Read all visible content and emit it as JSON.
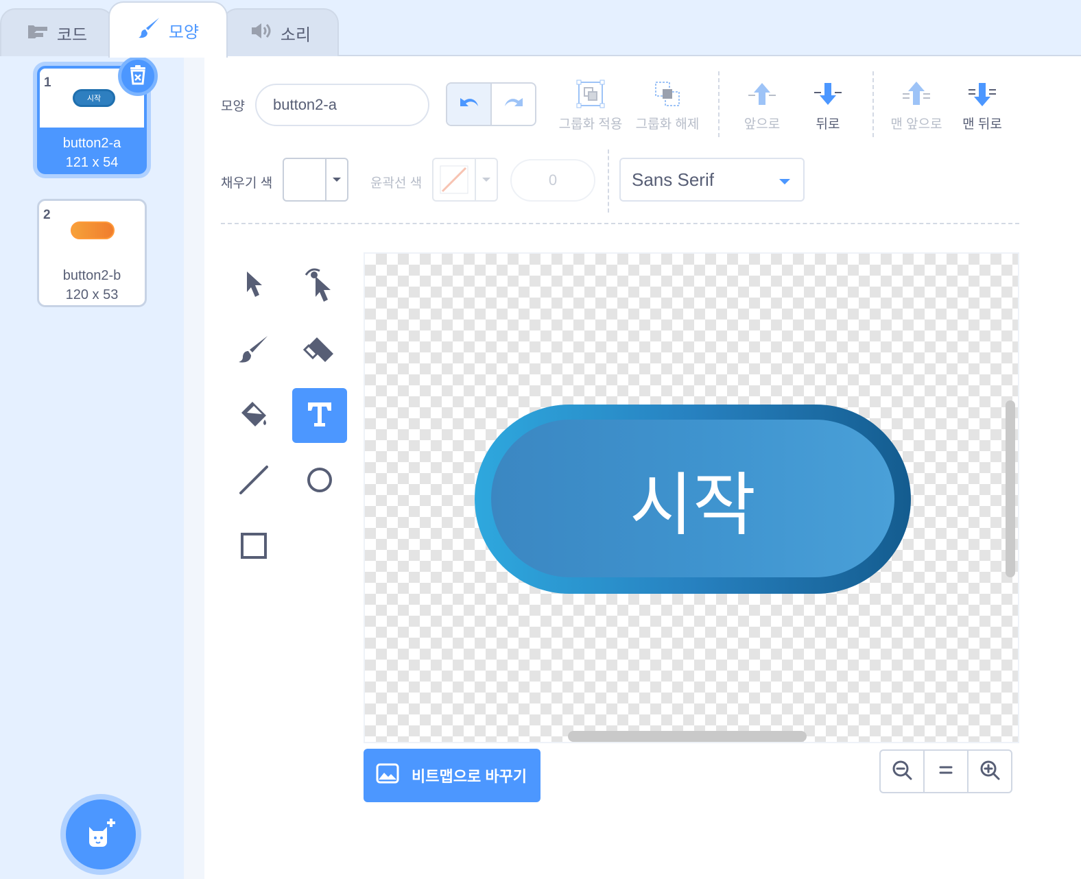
{
  "tabs": [
    {
      "label": "코드",
      "icon": "code-blocks-icon"
    },
    {
      "label": "모양",
      "icon": "paintbrush-icon",
      "active": true
    },
    {
      "label": "소리",
      "icon": "speaker-icon"
    }
  ],
  "costumes": [
    {
      "number": "1",
      "name": "button2-a",
      "size": "121 x 54",
      "thumb_text": "시작",
      "selected": true
    },
    {
      "number": "2",
      "name": "button2-b",
      "size": "120 x 53",
      "selected": false
    }
  ],
  "toolbar": {
    "costume_label": "모양",
    "costume_name": "button2-a",
    "group": "그룹화 적용",
    "ungroup": "그룹화 해제",
    "forward": "앞으로",
    "backward": "뒤로",
    "front": "맨 앞으로",
    "back": "맨 뒤로"
  },
  "style": {
    "fill_label": "채우기 색",
    "fill_color": "#ffffff",
    "outline_label": "윤곽선 색",
    "outline_width": "0",
    "font": "Sans Serif"
  },
  "tools": [
    "select-tool",
    "reshape-tool",
    "brush-tool",
    "eraser-tool",
    "fill-tool",
    "text-tool",
    "line-tool",
    "circle-tool",
    "rectangle-tool"
  ],
  "active_tool": "text-tool",
  "canvas": {
    "button_text": "시작"
  },
  "convert_button": "비트맵으로 바꾸기",
  "colors": {
    "accent": "#4c97ff",
    "text": "#575e75",
    "background": "#e5f0ff"
  }
}
